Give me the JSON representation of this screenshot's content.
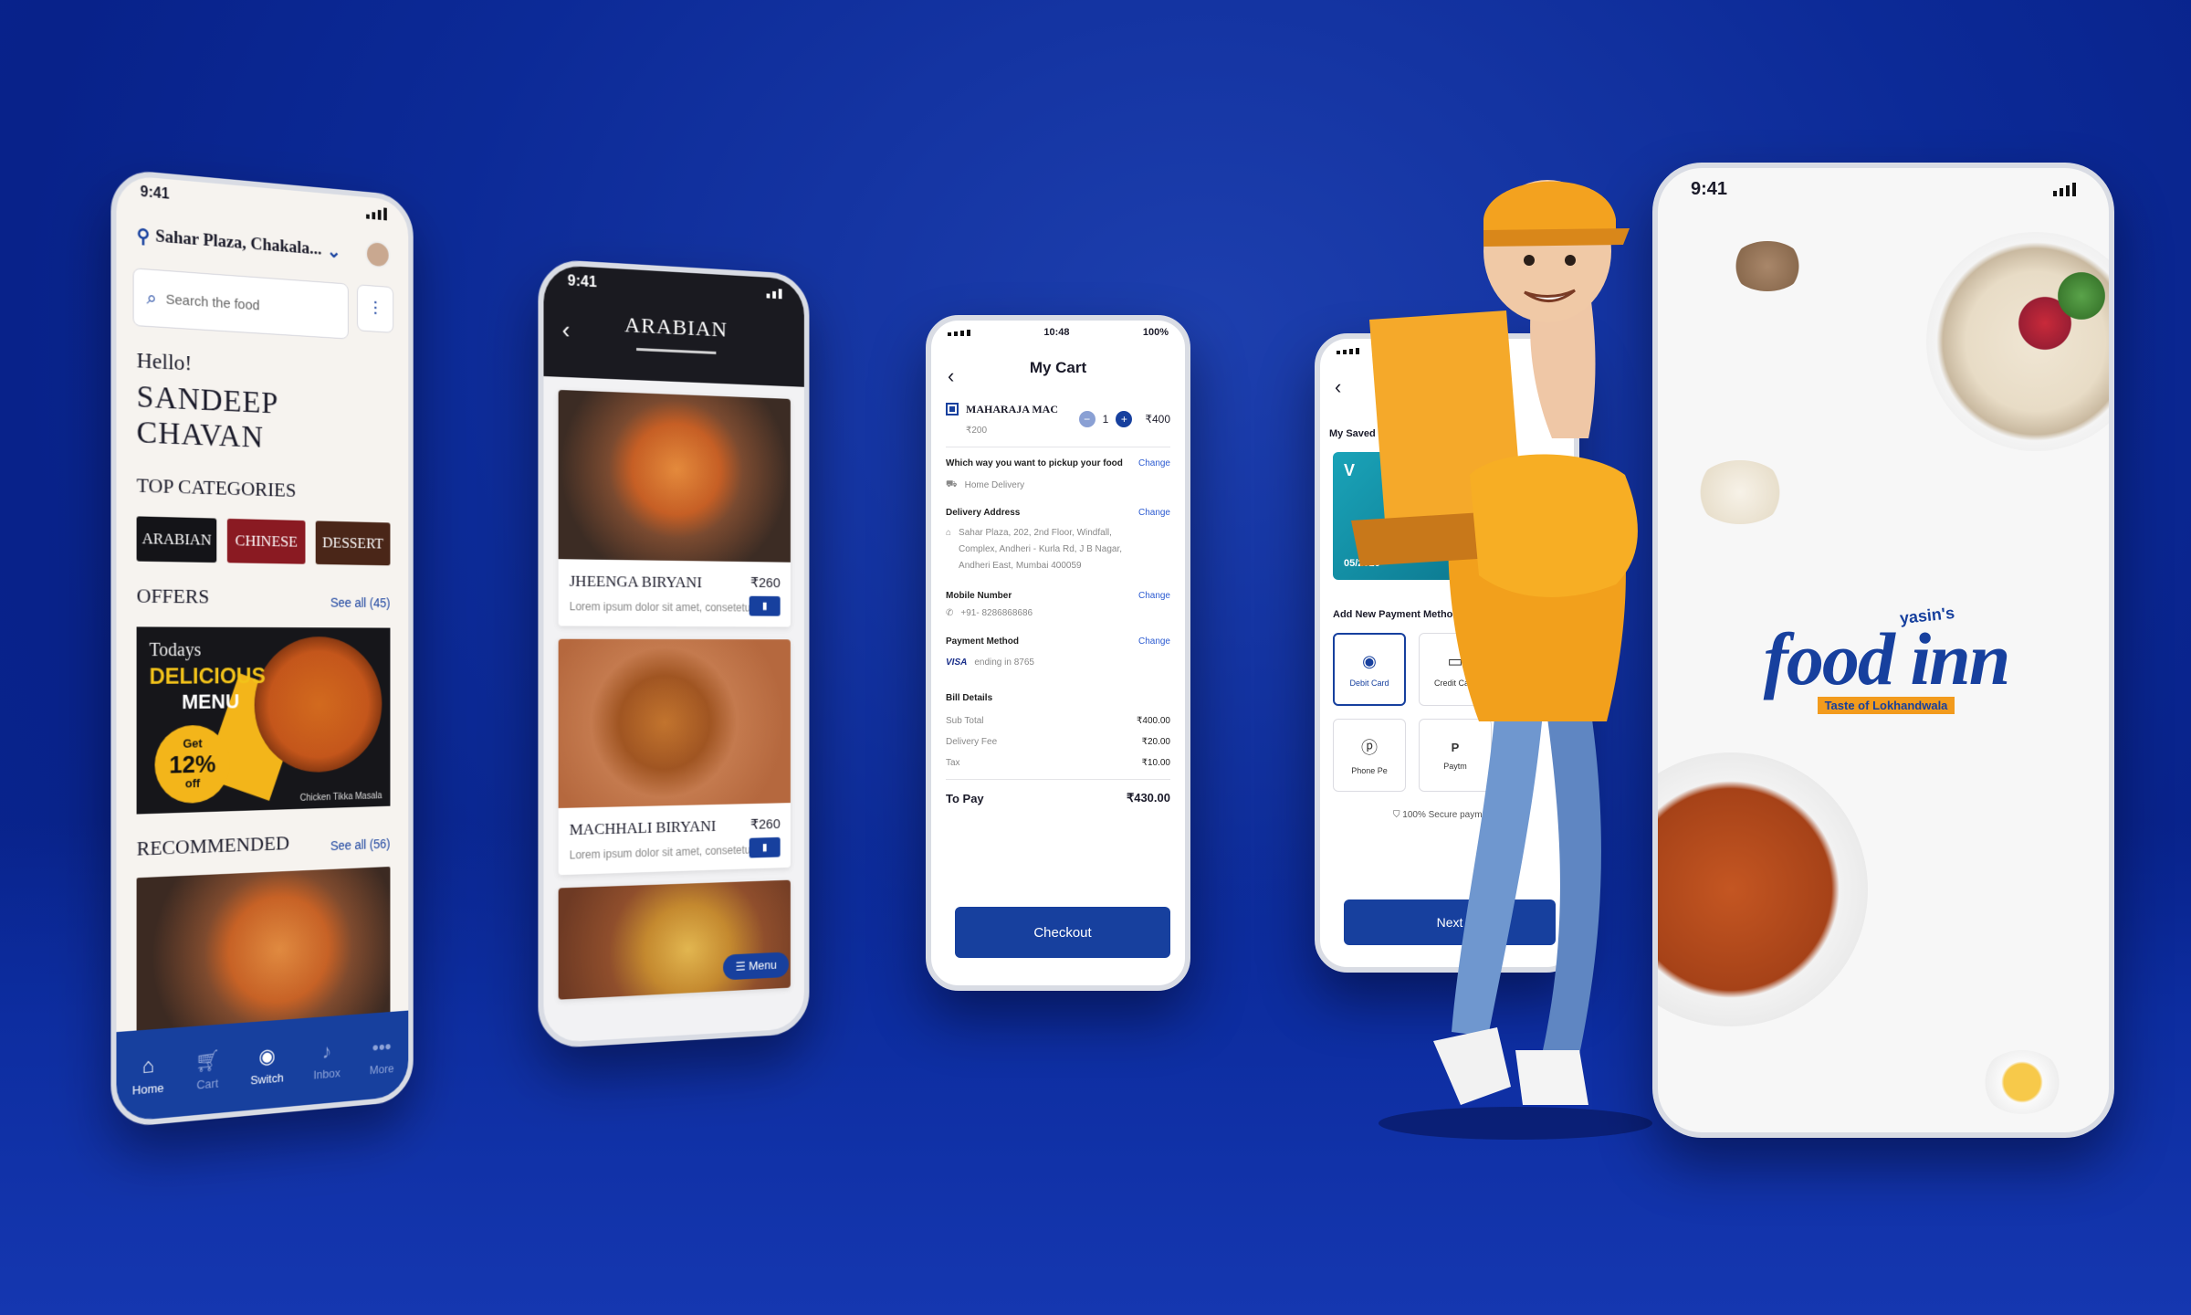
{
  "phone1": {
    "time": "9:41",
    "location": "Sahar Plaza, Chakala...",
    "search_placeholder": "Search the food",
    "greeting": "Hello!",
    "user_name": "SANDEEP CHAVAN",
    "top_categories_title": "TOP CATEGORIES",
    "categories": [
      "ARABIAN",
      "CHINESE",
      "DESSERT"
    ],
    "category_colors": [
      "#141418",
      "#8a1a22",
      "#4a2618"
    ],
    "offers_title": "OFFERS",
    "offers_see_all": "See all (45)",
    "offer_banner": {
      "line1": "Todays",
      "line2": "DELICIOUS",
      "line3": "MENU",
      "badge_top": "Get",
      "badge_mid": "12%",
      "badge_bottom": "off",
      "caption": "Chicken Tikka Masala"
    },
    "recommended_title": "RECOMMENDED",
    "recommended_see_all": "See all (56)",
    "tabs": [
      "Home",
      "Cart",
      "Switch",
      "Inbox",
      "More"
    ]
  },
  "phone2": {
    "time": "9:41",
    "title": "ARABIAN",
    "dishes": [
      {
        "name": "JHEENGA BIRYANI",
        "price": "₹260",
        "desc": "Lorem ipsum dolor sit amet, consetetur"
      },
      {
        "name": "MACHHALI BIRYANI",
        "price": "₹260",
        "desc": "Lorem ipsum dolor sit amet, consetetur"
      }
    ],
    "menu_button": "Menu"
  },
  "phone3": {
    "time": "10:48",
    "battery": "100%",
    "title": "My Cart",
    "item": {
      "name": "MAHARAJA MAC",
      "sub": "₹200",
      "qty": "1",
      "price": "₹400"
    },
    "pickup_label": "Which way you want to pickup your food",
    "pickup_value": "Home Delivery",
    "change": "Change",
    "address_label": "Delivery Address",
    "address_value": "Sahar Plaza, 202, 2nd Floor, Windfall, Complex, Andheri - Kurla Rd, J B Nagar, Andheri East, Mumbai 400059",
    "mobile_label": "Mobile Number",
    "mobile_value": "+91- 8286868686",
    "payment_label": "Payment Method",
    "payment_brand": "VISA",
    "payment_value": "ending in 8765",
    "bill_label": "Bill Details",
    "bill": [
      {
        "k": "Sub Total",
        "v": "₹400.00"
      },
      {
        "k": "Delivery Fee",
        "v": "₹20.00"
      },
      {
        "k": "Tax",
        "v": "₹10.00"
      }
    ],
    "to_pay_label": "To Pay",
    "to_pay_value": "₹430.00",
    "checkout": "Checkout"
  },
  "phone4": {
    "saved_label": "My Saved",
    "card_date": "05/2020",
    "card_letter": "V",
    "add_label": "Add New Payment Methods",
    "methods": [
      "Debit Card",
      "Credit Card",
      "Phone Pe",
      "Paytm"
    ],
    "secure": "100% Secure payment",
    "next": "Next"
  },
  "phone5": {
    "time": "9:41",
    "brand_top": "yasin's",
    "brand_main": "food inn",
    "brand_tag": "Taste of Lokhandwala"
  },
  "colors": {
    "primary": "#17409e",
    "accent": "#f29b1d",
    "background": "#0c2a97"
  }
}
